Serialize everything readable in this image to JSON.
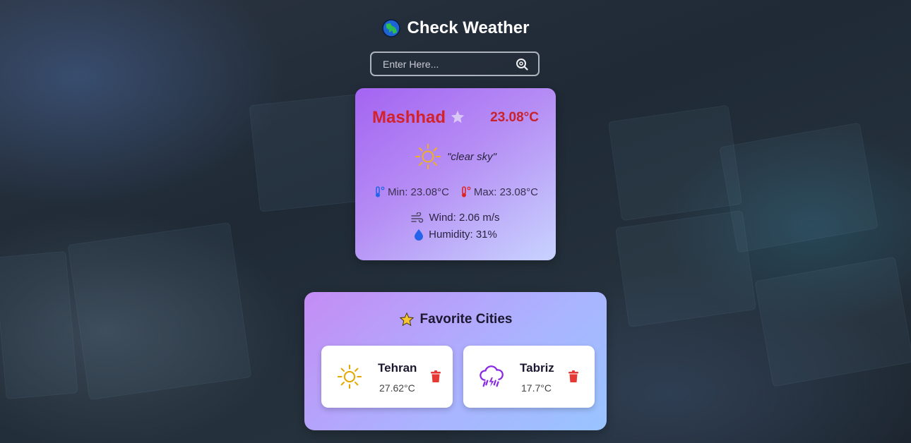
{
  "app": {
    "title": "Check Weather"
  },
  "search": {
    "placeholder": "Enter Here..."
  },
  "current": {
    "city": "Mashhad",
    "temperature": "23.08°C",
    "description": "\"clear sky\"",
    "min": "Min: 23.08°C",
    "max": "Max: 23.08°C",
    "wind": "Wind: 2.06 m/s",
    "humidity": "Humidity: 31%"
  },
  "favorites": {
    "title": "Favorite Cities",
    "cities": [
      {
        "name": "Tehran",
        "temperature": "27.62°C",
        "icon": "sun-icon"
      },
      {
        "name": "Tabriz",
        "temperature": "17.7°C",
        "icon": "thunderstorm-icon"
      }
    ]
  },
  "colors": {
    "accent_red": "#d4222a",
    "sun": "#f0b020",
    "storm": "#8a2be2",
    "trash": "#e53935"
  }
}
